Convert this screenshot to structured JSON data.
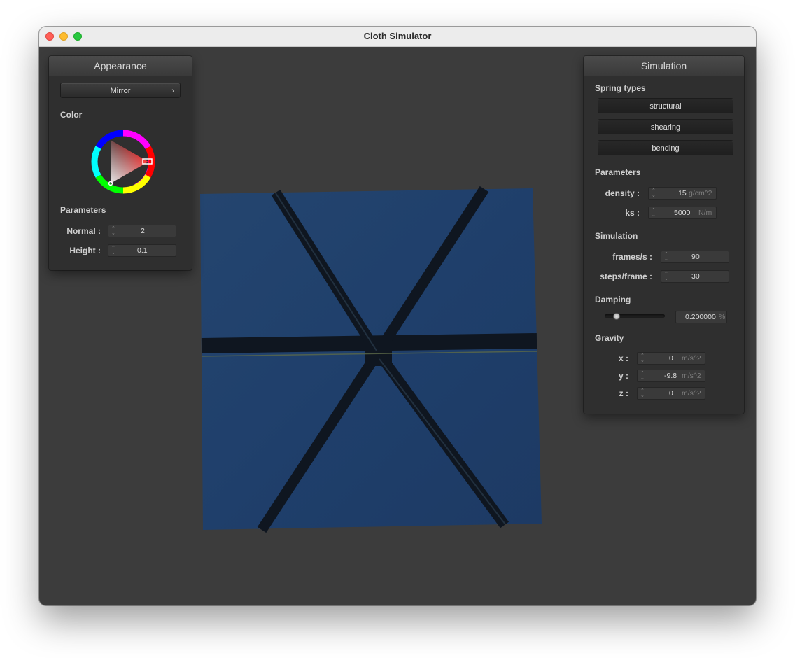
{
  "window": {
    "title": "Cloth Simulator"
  },
  "appearance": {
    "header": "Appearance",
    "shader_dropdown": "Mirror",
    "color_label": "Color",
    "color_picker": {
      "hue_hex": "#ff0000",
      "selected_hex": "#ff0000"
    },
    "parameters_label": "Parameters",
    "normal": {
      "label": "Normal :",
      "value": "2"
    },
    "height": {
      "label": "Height :",
      "value": "0.1"
    }
  },
  "simulation": {
    "header": "Simulation",
    "spring_types_label": "Spring types",
    "spring_buttons": [
      "structural",
      "shearing",
      "bending"
    ],
    "parameters_label": "Parameters",
    "density": {
      "label": "density :",
      "value": "15",
      "unit": "g/cm^2"
    },
    "ks": {
      "label": "ks :",
      "value": "5000",
      "unit": "N/m"
    },
    "simulation_label": "Simulation",
    "frames": {
      "label": "frames/s :",
      "value": "90"
    },
    "steps": {
      "label": "steps/frame :",
      "value": "30"
    },
    "damping_label": "Damping",
    "damping": {
      "value": "0.200000",
      "unit": "%",
      "slider_fraction": 0.2
    },
    "gravity_label": "Gravity",
    "gx": {
      "label": "x :",
      "value": "0",
      "unit": "m/s^2"
    },
    "gy": {
      "label": "y :",
      "value": "-9.8",
      "unit": "m/s^2"
    },
    "gz": {
      "label": "z :",
      "value": "0",
      "unit": "m/s^2"
    }
  },
  "scene": {
    "cloth_color": "#203f6e",
    "beam_color": "#0f1620"
  }
}
